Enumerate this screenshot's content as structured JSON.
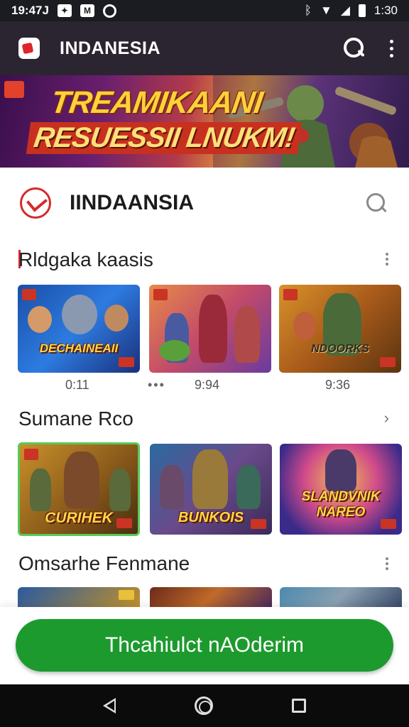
{
  "status_bar": {
    "time_left": "19:47J",
    "time_right": "1:30",
    "icon_names": [
      "notification-icon",
      "gmail-icon",
      "sync-icon",
      "bluetooth-icon",
      "wifi-icon",
      "signal-icon",
      "battery-icon"
    ]
  },
  "app_bar": {
    "title": "INDANESIA",
    "icons": [
      "app-logo-icon",
      "search-icon",
      "more-vert-icon"
    ]
  },
  "banner": {
    "line1": "TREAMIKAANI",
    "line2": "RESUESSII LNUKM!"
  },
  "store": {
    "title": "IINDAANSIA"
  },
  "sections": [
    {
      "title": "Rldgaka kaasis",
      "tiles": [
        {
          "label": "DECHAINEAII",
          "time": "0:11"
        },
        {
          "label": "",
          "time": "9:94",
          "dots": "•••"
        },
        {
          "label": "NDOORKS",
          "time": "9:36"
        }
      ]
    },
    {
      "title": "Sumane Rco",
      "tiles": [
        {
          "label": "CURIHEK"
        },
        {
          "label": "BUNKOIS"
        },
        {
          "label": "SLANDVNIK NAREO"
        }
      ]
    },
    {
      "title": "Omsarhe Fenmane",
      "tiles": [
        {
          "label": ""
        },
        {
          "label": ""
        },
        {
          "label": ""
        }
      ]
    }
  ],
  "cta": {
    "label": "Thcahiulct nAOderim"
  },
  "colors": {
    "app_bar": "#2a2530",
    "cta_green": "#1d9a2e",
    "accent_red": "#d62a2a"
  }
}
